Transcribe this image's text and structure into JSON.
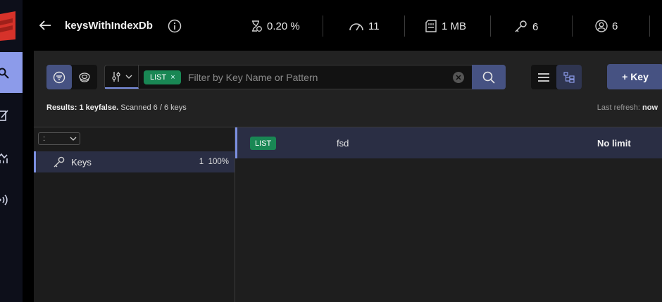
{
  "header": {
    "db_name": "keysWithIndexDb",
    "stats": [
      {
        "icon": "cpu-timer-icon",
        "value": "0.20 %"
      },
      {
        "icon": "speedometer-icon",
        "value": "11"
      },
      {
        "icon": "memory-icon",
        "value": "1 MB"
      },
      {
        "icon": "key-icon",
        "value": "6"
      },
      {
        "icon": "user-icon",
        "value": "6"
      }
    ]
  },
  "toolbar": {
    "type_filter_chip": "LIST",
    "chip_remove": "×",
    "filter_placeholder": "Filter by Key Name or Pattern",
    "filter_value": "",
    "add_key_label": "+ Key"
  },
  "results": {
    "prefix": "Results:",
    "count": "1 keyfalse.",
    "scanned": "Scanned 6 / 6 keys",
    "refresh_label": "Last refresh:",
    "refresh_value": "now"
  },
  "tree": {
    "delimiter": ":",
    "items": [
      {
        "label": "Keys",
        "count": "1",
        "percent": "100%"
      }
    ]
  },
  "key_list": {
    "rows": [
      {
        "type": "LIST",
        "name": "fsd",
        "ttl": "No limit"
      }
    ]
  },
  "colors": {
    "accent": "#465282",
    "active_nav": "#8c9bea",
    "list_chip": "#198754",
    "brand_red": "#d6322a"
  }
}
